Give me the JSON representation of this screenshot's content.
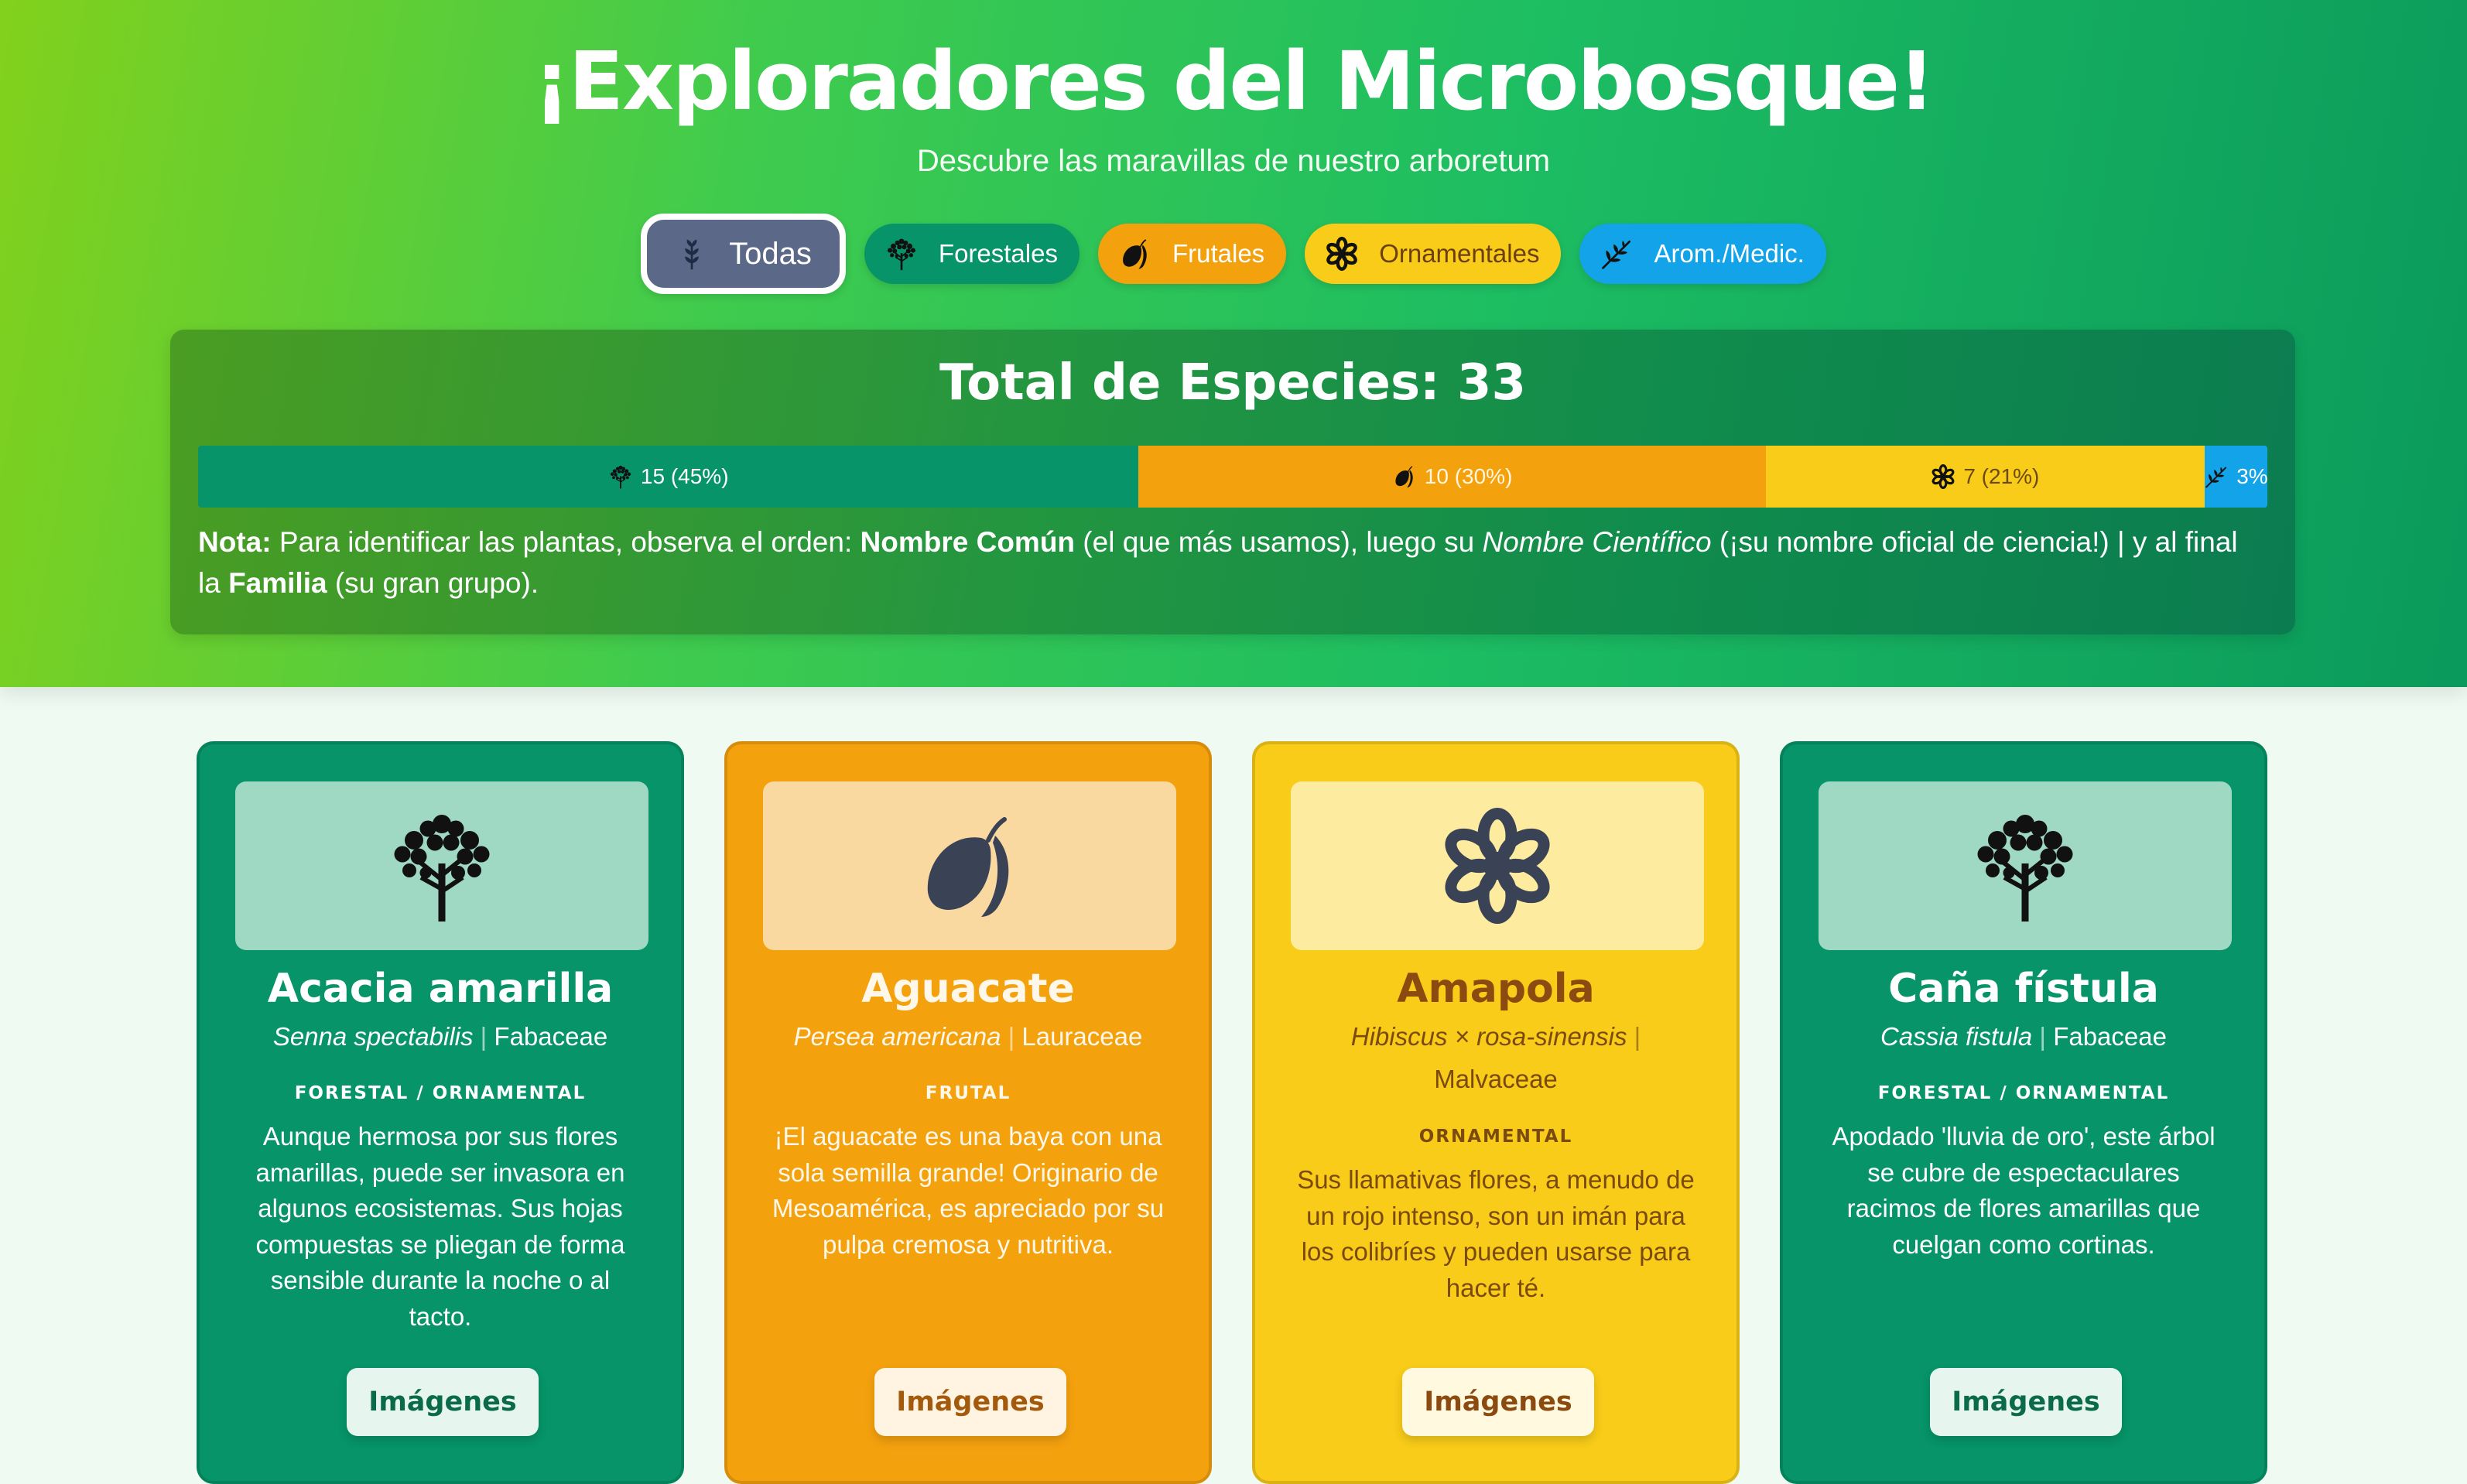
{
  "header": {
    "title": "¡Exploradores del Microbosque!",
    "subtitle": "Descubre las maravillas de nuestro arboretum"
  },
  "filters": [
    {
      "label": "Todas",
      "icon": "sprout-icon",
      "active": true
    },
    {
      "label": "Forestales",
      "icon": "tree-icon",
      "active": false
    },
    {
      "label": "Frutales",
      "icon": "mango-icon",
      "active": false
    },
    {
      "label": "Ornamentales",
      "icon": "flower-icon",
      "active": false
    },
    {
      "label": "Arom./Medic.",
      "icon": "herb-icon",
      "active": false
    }
  ],
  "summary": {
    "title": "Total de Especies: 33",
    "total": 33,
    "segments": [
      {
        "category": "forestales",
        "icon": "tree-icon",
        "label": "15 (45%)",
        "count": 15,
        "percent": 45,
        "color": "#069468"
      },
      {
        "category": "frutales",
        "icon": "mango-icon",
        "label": "10 (30%)",
        "count": 10,
        "percent": 30,
        "color": "#f4a10e"
      },
      {
        "category": "ornamentales",
        "icon": "flower-icon",
        "label": "7 (21%)",
        "count": 7,
        "percent": 21,
        "color": "#f8cc18"
      },
      {
        "category": "aromaticas",
        "icon": "herb-icon",
        "label": "3%",
        "count": 1,
        "percent": 3,
        "color": "#12a3e8"
      }
    ],
    "note": {
      "label": "Nota:",
      "t1": " Para identificar las plantas, observa el orden: ",
      "common": "Nombre Común",
      "t2": " (el que más usamos), luego su ",
      "scientific": "Nombre Científico",
      "t3": " (¡su nombre oficial de ciencia!) | y al final la ",
      "family": "Familia",
      "t4": " (su gran grupo)."
    }
  },
  "cards": [
    {
      "type": "forest",
      "icon": "tree-icon",
      "name": "Acacia amarilla",
      "scientific": "Senna spectabilis",
      "family": "Fabaceae",
      "category": "FORESTAL / ORNAMENTAL",
      "description": "Aunque hermosa por sus flores amarillas, puede ser invasora en algunos ecosistemas. Sus hojas compuestas se pliegan de forma sensible durante la noche o al tacto.",
      "button": "Imágenes"
    },
    {
      "type": "fruit",
      "icon": "mango-icon",
      "name": "Aguacate",
      "scientific": "Persea americana",
      "family": "Lauraceae",
      "category": "FRUTAL",
      "description": "¡El aguacate es una baya con una sola semilla grande! Originario de Mesoamérica, es apreciado por su pulpa cremosa y nutritiva.",
      "button": "Imágenes"
    },
    {
      "type": "orn",
      "icon": "flower-icon",
      "name": "Amapola",
      "scientific": "Hibiscus × rosa-sinensis",
      "family": "Malvaceae",
      "category": "ORNAMENTAL",
      "description": "Sus llamativas flores, a menudo de un rojo intenso, son un imán para los colibríes y pueden usarse para hacer té.",
      "button": "Imágenes"
    },
    {
      "type": "forest",
      "icon": "tree-icon",
      "name": "Caña fístula",
      "scientific": "Cassia fistula",
      "family": "Fabaceae",
      "category": "FORESTAL / ORNAMENTAL",
      "description": "Apodado 'lluvia de oro', este árbol se cubre de espectaculares racimos de flores amarillas que cuelgan como cortinas.",
      "button": "Imágenes"
    }
  ]
}
